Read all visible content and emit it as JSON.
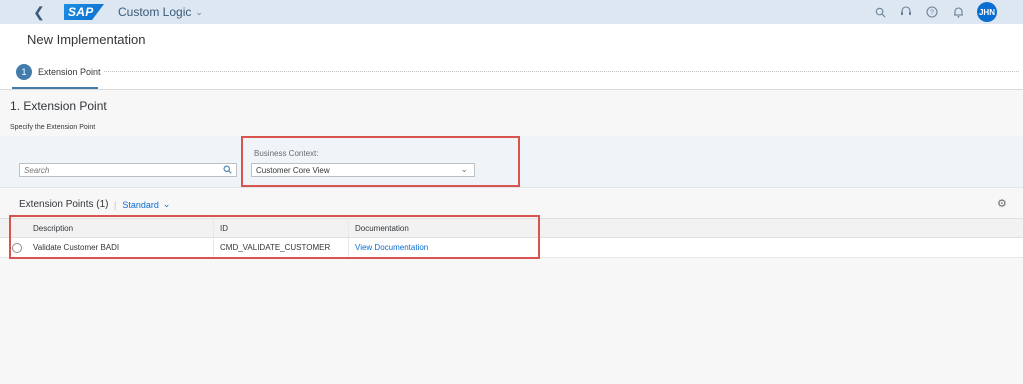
{
  "shell": {
    "logo_text": "SAP",
    "app_title": "Custom Logic",
    "avatar_initials": "JHN",
    "brand_color": "#0a6ed1"
  },
  "header": {
    "title": "New Implementation",
    "step_number": "1",
    "step_label": "Extension Point"
  },
  "section": {
    "title": "1. Extension Point",
    "subtitle": "Specify the Extension Point"
  },
  "filters": {
    "search_placeholder": "Search",
    "business_context_label": "Business Context:",
    "business_context_value": "Customer Core View"
  },
  "table": {
    "title": "Extension Points (1)",
    "variant": "Standard",
    "columns": [
      "Description",
      "ID",
      "Documentation"
    ],
    "rows": [
      {
        "description": "Validate Customer BADI",
        "id": "CMD_VALIDATE_CUSTOMER",
        "documentation": "View Documentation"
      }
    ]
  },
  "highlight_color": "#d9534f"
}
